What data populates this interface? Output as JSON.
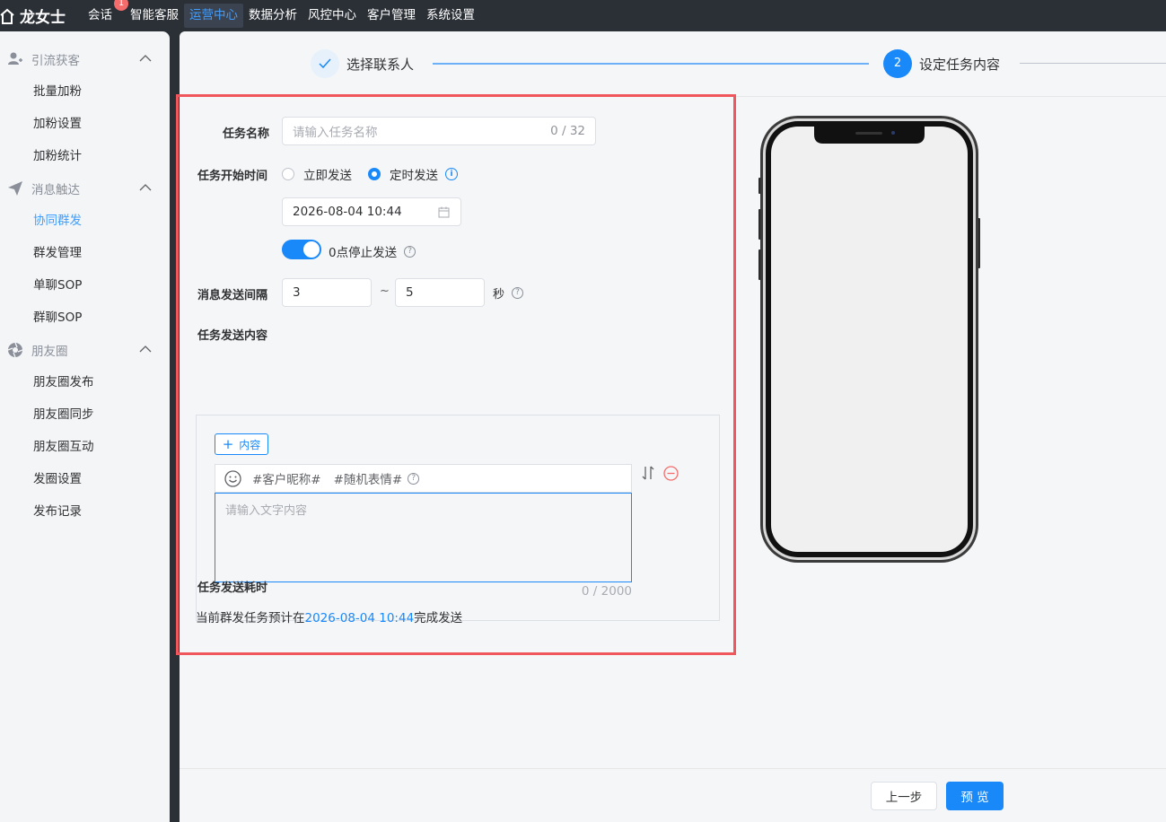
{
  "app": {
    "brand": "龙女士"
  },
  "nav": {
    "items": [
      {
        "label": "会话",
        "badge": "1"
      },
      {
        "label": "智能客服"
      },
      {
        "label": "运营中心",
        "active": true
      },
      {
        "label": "数据分析"
      },
      {
        "label": "风控中心"
      },
      {
        "label": "客户管理"
      },
      {
        "label": "系统设置"
      }
    ]
  },
  "sidebar": {
    "groups": [
      {
        "label": "引流获客",
        "icon": "user-add-icon",
        "items": [
          "批量加粉",
          "加粉设置",
          "加粉统计"
        ]
      },
      {
        "label": "消息触达",
        "icon": "send-icon",
        "items": [
          "协同群发",
          "群发管理",
          "单聊SOP",
          "群聊SOP"
        ]
      },
      {
        "label": "朋友圈",
        "icon": "aperture-icon",
        "items": [
          "朋友圈发布",
          "朋友圈同步",
          "朋友圈互动",
          "发圈设置",
          "发布记录"
        ]
      }
    ],
    "active_item": "协同群发"
  },
  "steps": {
    "step1": "选择联系人",
    "step2_number": "2",
    "step2": "设定任务内容"
  },
  "form": {
    "task_name_label": "任务名称",
    "task_name_placeholder": "请输入任务名称",
    "task_name_count": "0 / 32",
    "start_time_label": "任务开始时间",
    "radio_now": "立即发送",
    "radio_scheduled": "定时发送",
    "scheduled_selected": true,
    "datetime_value": "2026-08-04 10:44",
    "stop_at_midnight_label": "0点停止发送",
    "stop_at_midnight_on": true,
    "interval_label": "消息发送间隔",
    "interval_min": "3",
    "interval_sep": "~",
    "interval_max": "5",
    "interval_unit": "秒",
    "content_label": "任务发送内容",
    "add_content_label": "内容",
    "tag_nickname": "#客户昵称#",
    "tag_emoji": "#随机表情#",
    "text_placeholder": "请输入文字内容",
    "text_count": "0 / 2000",
    "duration_label": "任务发送耗时",
    "estimate_prefix": "当前群发任务预计在",
    "estimate_time": "2026-08-04 10:44",
    "estimate_suffix": "完成发送"
  },
  "footer": {
    "prev_label": "上一步",
    "preview_label": "预 览"
  },
  "colors": {
    "primary": "#1989fa",
    "highlight_border": "#f0575c",
    "nav_bg": "#2b2f36"
  }
}
